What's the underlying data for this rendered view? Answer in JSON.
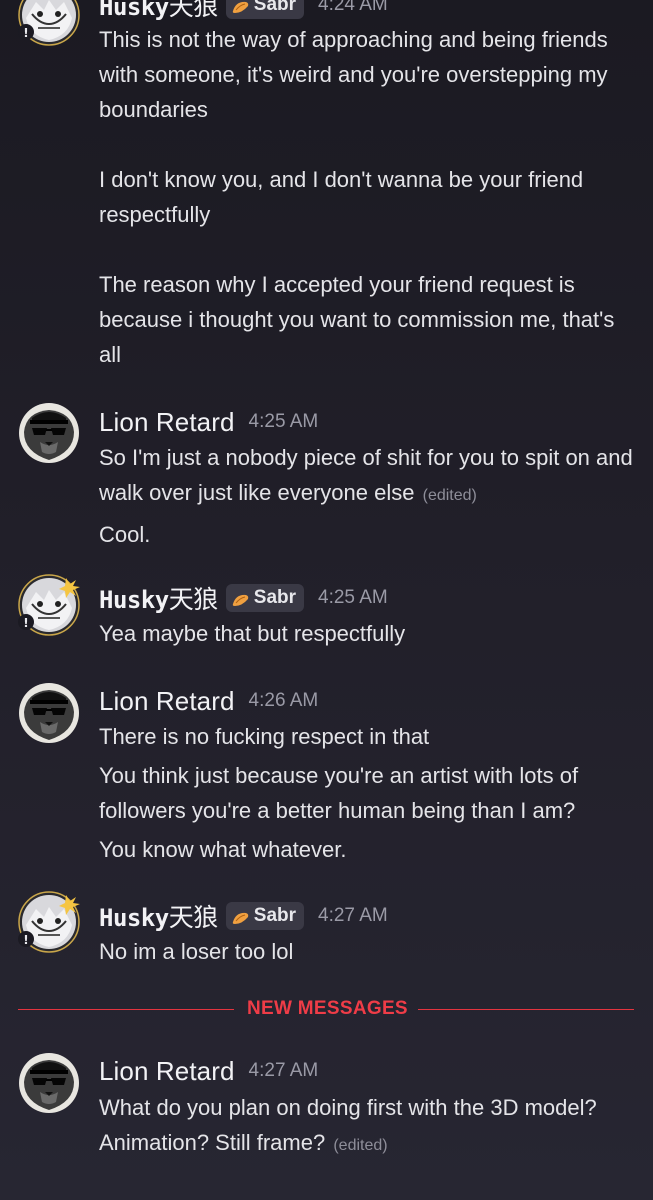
{
  "messages": [
    {
      "id": "m1",
      "author": {
        "name_latin": "Husky",
        "name_cjk": "天狼",
        "tag": "Sabr",
        "avatar": "husky-avatar"
      },
      "timestamp": "4:24 AM",
      "lines": [
        "This is not the way of approaching and being friends with someone, it's weird and you're overstepping my boundaries",
        "I don't know you, and I don't wanna be your friend respectfully",
        "The reason why I accepted your friend request is because i thought you want to commission me, that's all"
      ]
    },
    {
      "id": "m2",
      "author": {
        "name": "Lion Retard",
        "avatar": "lion-avatar"
      },
      "timestamp": "4:25 AM",
      "lines": [
        "So I'm just a nobody piece of shit for you to spit on and walk over just like everyone else",
        "Cool."
      ],
      "edited_label": "(edited)"
    },
    {
      "id": "m3",
      "author": {
        "name_latin": "Husky",
        "name_cjk": "天狼",
        "tag": "Sabr",
        "avatar": "husky-avatar"
      },
      "timestamp": "4:25 AM",
      "lines": [
        "Yea maybe that but respectfully"
      ]
    },
    {
      "id": "m4",
      "author": {
        "name": "Lion Retard",
        "avatar": "lion-avatar"
      },
      "timestamp": "4:26 AM",
      "lines": [
        "There is no fucking respect in that",
        "You think just because you're an artist with lots of followers you're a better human being than I am?",
        "You know what whatever."
      ]
    },
    {
      "id": "m5",
      "author": {
        "name_latin": "Husky",
        "name_cjk": "天狼",
        "tag": "Sabr",
        "avatar": "husky-avatar"
      },
      "timestamp": "4:27 AM",
      "lines": [
        "No im a loser too lol"
      ]
    },
    {
      "id": "m6",
      "author": {
        "name": "Lion Retard",
        "avatar": "lion-avatar"
      },
      "timestamp": "4:27 AM",
      "lines": [
        "What do you plan on doing first with the 3D model? Animation? Still frame?"
      ],
      "edited_label": "(edited)"
    }
  ],
  "divider": {
    "label": "NEW MESSAGES",
    "color": "#ef3c47"
  },
  "colors": {
    "background": "#1f1e27",
    "text": "#e4e4e8",
    "muted": "#9a9aa6",
    "tag_bg": "#3a3945",
    "accent_red": "#e3343f"
  }
}
